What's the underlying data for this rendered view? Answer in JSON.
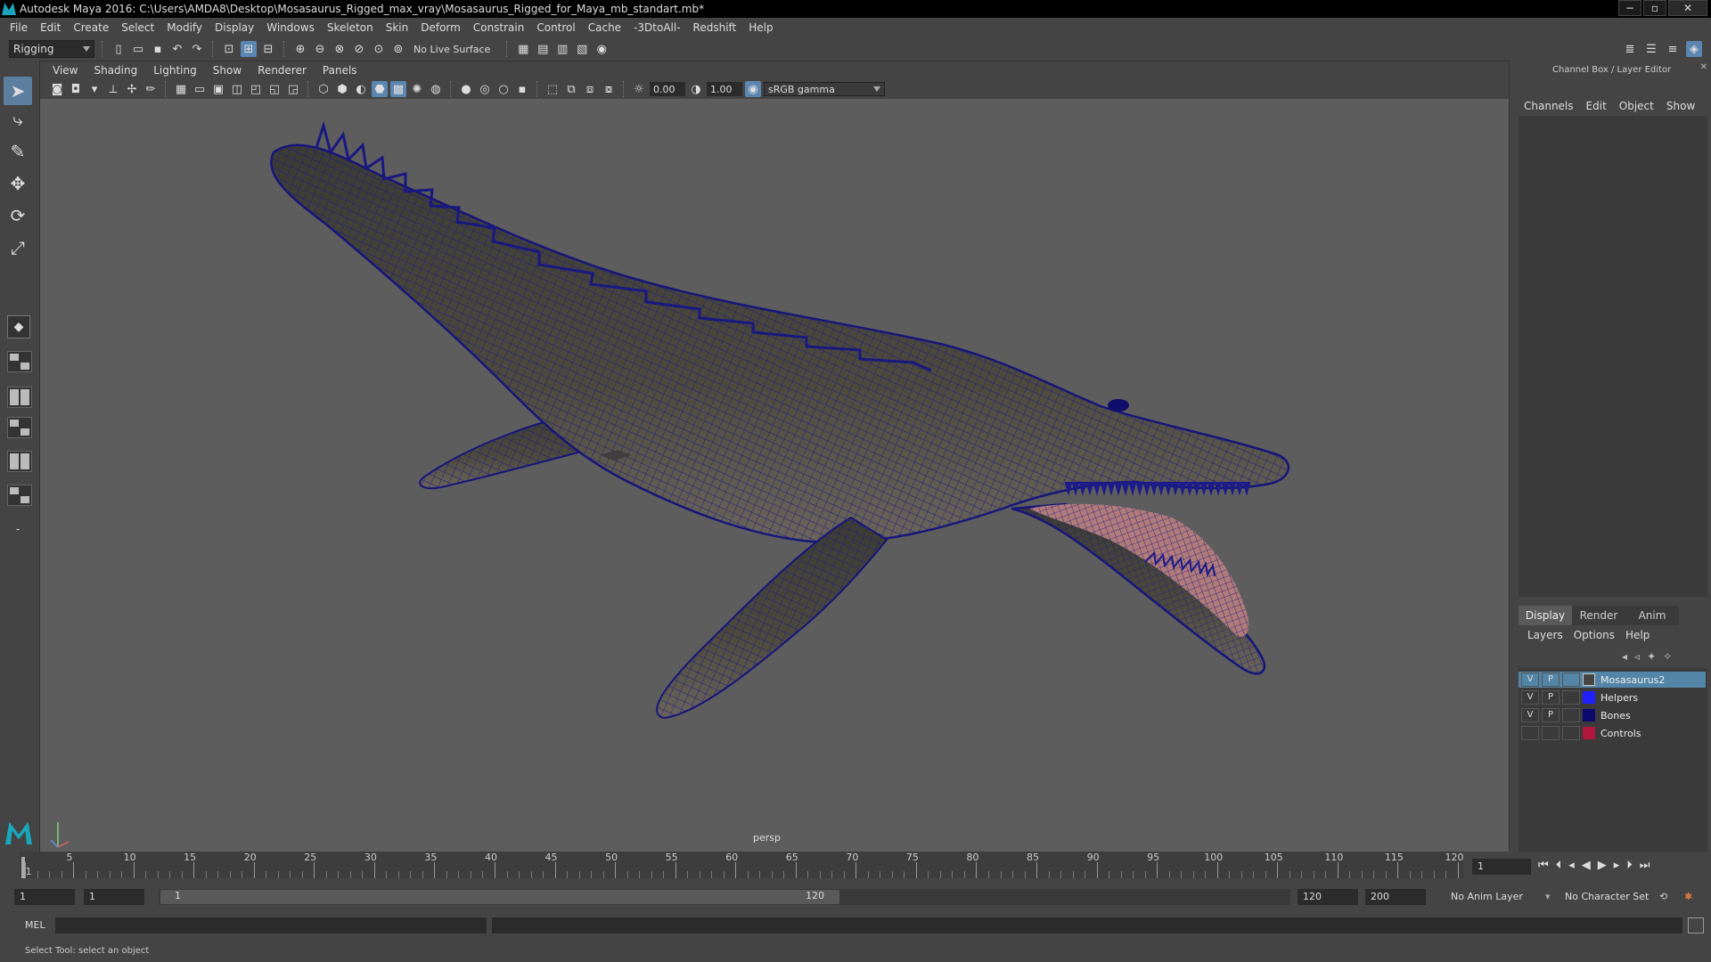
{
  "window": {
    "title": "Autodesk Maya 2016: C:\\Users\\AMDA8\\Desktop\\Mosasaurus_Rigged_max_vray\\Mosasaurus_Rigged_for_Maya_mb_standart.mb*",
    "min": "−",
    "max": "▫",
    "close": "✕"
  },
  "menubar": [
    "File",
    "Edit",
    "Create",
    "Select",
    "Modify",
    "Display",
    "Windows",
    "Skeleton",
    "Skin",
    "Deform",
    "Constrain",
    "Control",
    "Cache",
    "-3DtoAll-",
    "Redshift",
    "Help"
  ],
  "statusline": {
    "menuset": "Rigging",
    "live_surface": "No Live Surface"
  },
  "panel": {
    "menus": [
      "View",
      "Shading",
      "Lighting",
      "Show",
      "Renderer",
      "Panels"
    ],
    "exposure": "0.00",
    "gamma": "1.00",
    "color_space": "sRGB gamma",
    "camera": "persp"
  },
  "channelbox": {
    "title": "Channel Box / Layer Editor",
    "menus": [
      "Channels",
      "Edit",
      "Object",
      "Show"
    ],
    "tabs": [
      "Display",
      "Render",
      "Anim"
    ],
    "layer_menus": [
      "Layers",
      "Options",
      "Help"
    ],
    "layers": [
      {
        "v": "V",
        "p": "P",
        "name": "Mosasaurus2",
        "color": "#5285a6",
        "selected": true
      },
      {
        "v": "V",
        "p": "P",
        "name": "Helpers",
        "color": "#1f1fff",
        "selected": false
      },
      {
        "v": "V",
        "p": "P",
        "name": "Bones",
        "color": "#0a0a6e",
        "selected": false
      },
      {
        "v": "",
        "p": "",
        "name": "Controls",
        "color": "#b0153a",
        "selected": false
      }
    ]
  },
  "timeline": {
    "ticks": [
      1,
      5,
      10,
      15,
      20,
      25,
      30,
      35,
      40,
      45,
      50,
      55,
      60,
      65,
      70,
      75,
      80,
      85,
      90,
      95,
      100,
      105,
      110,
      115,
      120
    ],
    "current_frame": "1"
  },
  "range": {
    "start": "1",
    "playback_start": "1",
    "inner_start": "1",
    "inner_end": "120",
    "playback_end": "120",
    "end": "200",
    "anim_layer": "No Anim Layer",
    "character_set": "No Character Set"
  },
  "cmdline": {
    "label": "MEL"
  },
  "helpline": {
    "text": "Select Tool: select an object"
  },
  "colors": {
    "accent": "#5285a6",
    "wire": "#1a1a9a",
    "viewport_bg": "#5d5d5d"
  }
}
